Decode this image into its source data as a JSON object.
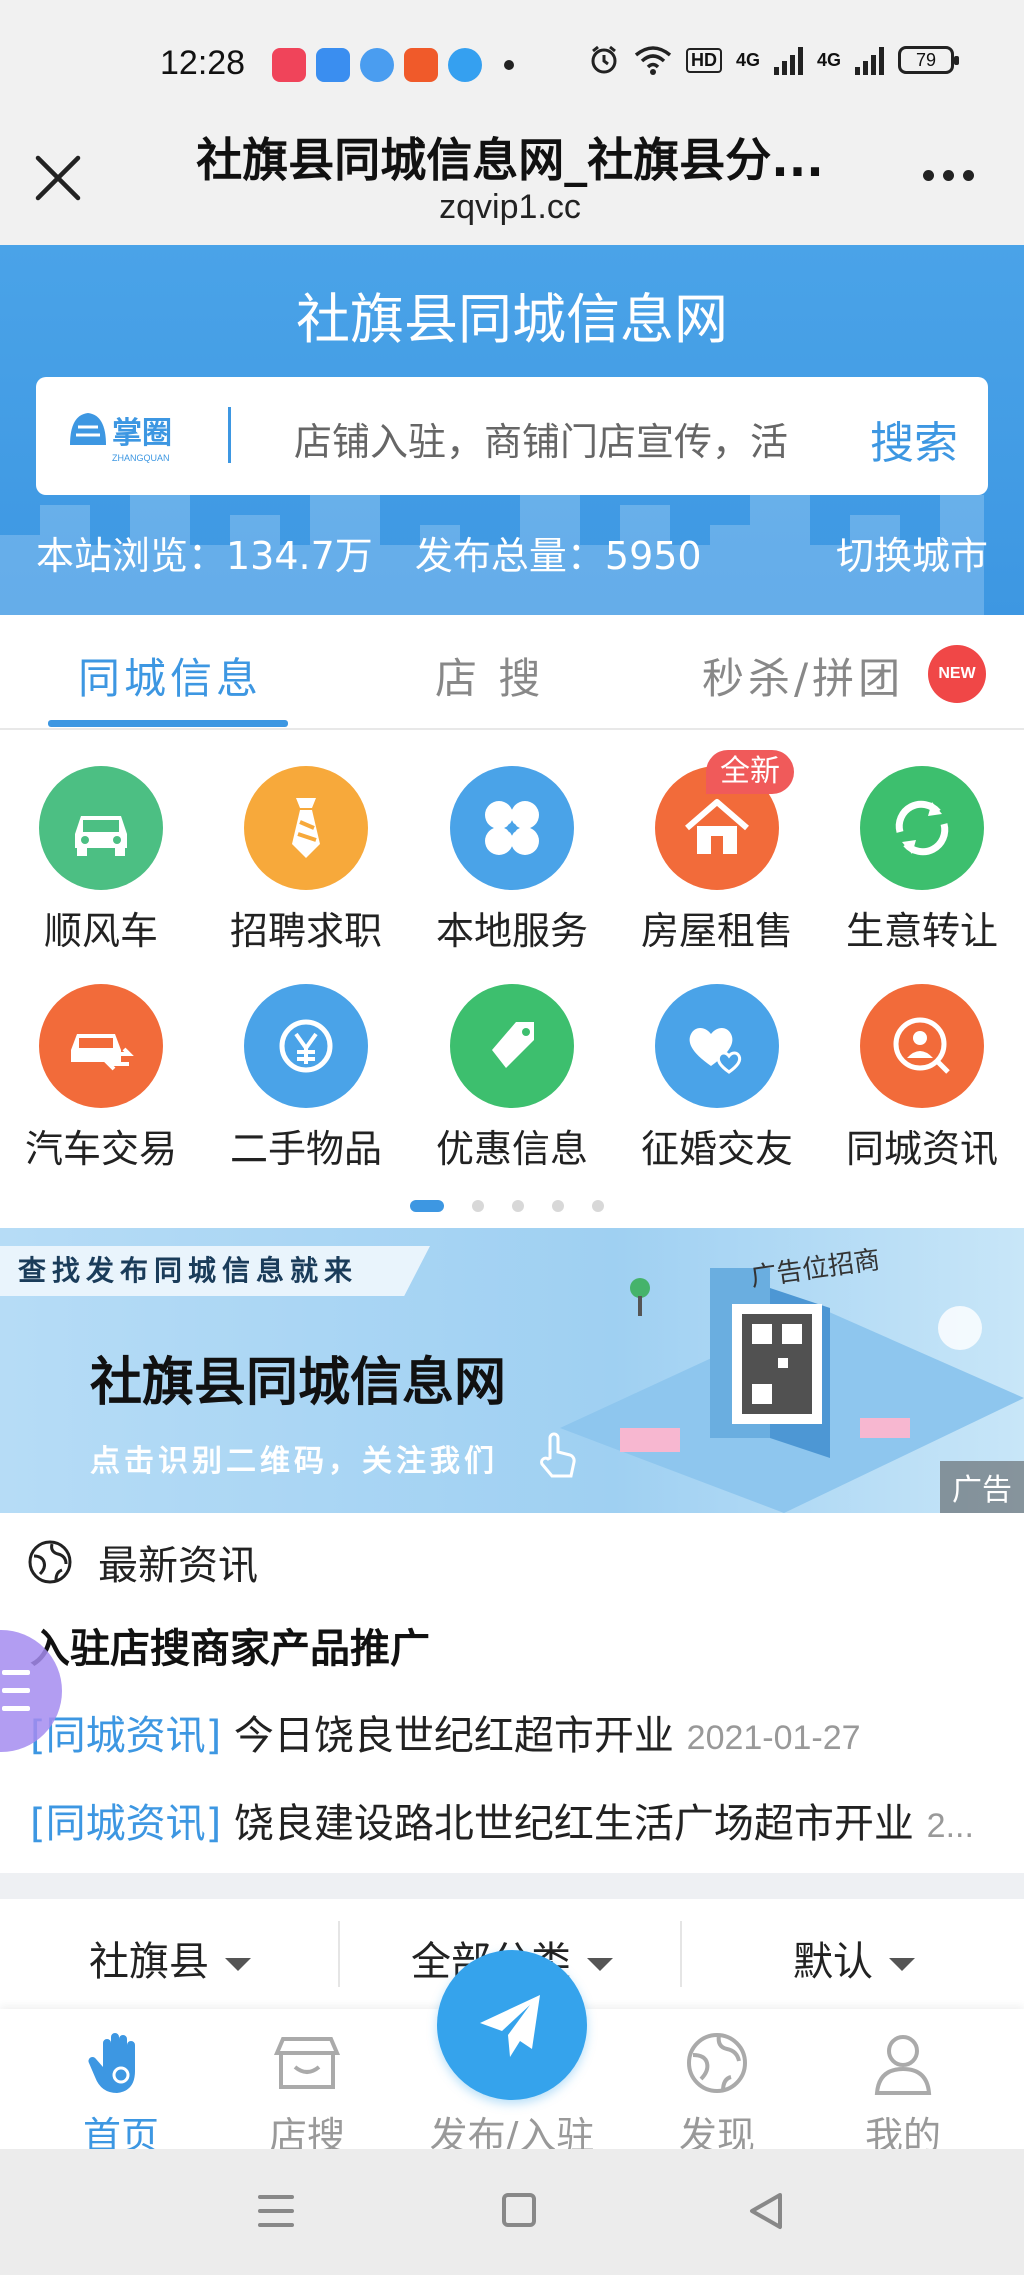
{
  "status_bar": {
    "time": "12:28",
    "network": "HD",
    "sim1": "4G",
    "sim2": "4G",
    "battery": "79"
  },
  "title_bar": {
    "title": "社旗县同城信息网_社旗县分...",
    "domain": "zqvip1.cc"
  },
  "header": {
    "site_title": "社旗县同城信息网",
    "search_placeholder": "店铺入驻，商铺门店宣传，活",
    "search_button": "搜索",
    "views_label": "本站浏览：134.7万",
    "posts_label": "发布总量：5950",
    "switch_city": "切换城市"
  },
  "tabs": [
    {
      "label": "同城信息",
      "active": true
    },
    {
      "label": "店 搜",
      "active": false
    },
    {
      "label": "秒杀/拼团",
      "active": false
    }
  ],
  "new_badge": "NEW",
  "categories": [
    {
      "label": "顺风车",
      "color": "#4cbf83",
      "icon": "car-icon"
    },
    {
      "label": "招聘求职",
      "color": "#f7a93b",
      "icon": "tie-icon"
    },
    {
      "label": "本地服务",
      "color": "#4aa3e8",
      "icon": "clover-icon"
    },
    {
      "label": "房屋租售",
      "color": "#f26b3a",
      "icon": "house-icon",
      "tag": "全新"
    },
    {
      "label": "生意转让",
      "color": "#3dbf6e",
      "icon": "refresh-icon"
    },
    {
      "label": "汽车交易",
      "color": "#f26b3a",
      "icon": "car-trade-icon"
    },
    {
      "label": "二手物品",
      "color": "#4aa3e8",
      "icon": "yen-icon"
    },
    {
      "label": "优惠信息",
      "color": "#3dbf6e",
      "icon": "price-tag-icon"
    },
    {
      "label": "征婚交友",
      "color": "#4aa3e8",
      "icon": "hearts-icon"
    },
    {
      "label": "同城资讯",
      "color": "#f26b3a",
      "icon": "user-search-icon"
    }
  ],
  "banner": {
    "tag": "查找发布同城信息就来",
    "title": "社旗县同城信息网",
    "subtitle": "点击识别二维码，关注我们",
    "ad_badge_text": "广告位招商",
    "ad_label": "广告"
  },
  "news": {
    "heading": "最新资讯",
    "feature": "入驻店搜商家产品推广",
    "items": [
      {
        "category": "[同城资讯]",
        "title": " 今日饶良世纪红超市开业 ",
        "date": "2021-01-27"
      },
      {
        "category": "[同城资讯]",
        "title": " 饶良建设路北世纪红生活广场超市开业 ",
        "date": "2..."
      }
    ]
  },
  "filters": [
    {
      "label": "社旗县"
    },
    {
      "label": "全部分类"
    },
    {
      "label": "默认"
    }
  ],
  "bottom_nav": [
    {
      "label": "首页",
      "active": true
    },
    {
      "label": "店搜",
      "active": false
    },
    {
      "label": "发布/入驻",
      "active": false
    },
    {
      "label": "发现",
      "active": false
    },
    {
      "label": "我的",
      "active": false
    }
  ],
  "accent_color": "#3d97e2"
}
